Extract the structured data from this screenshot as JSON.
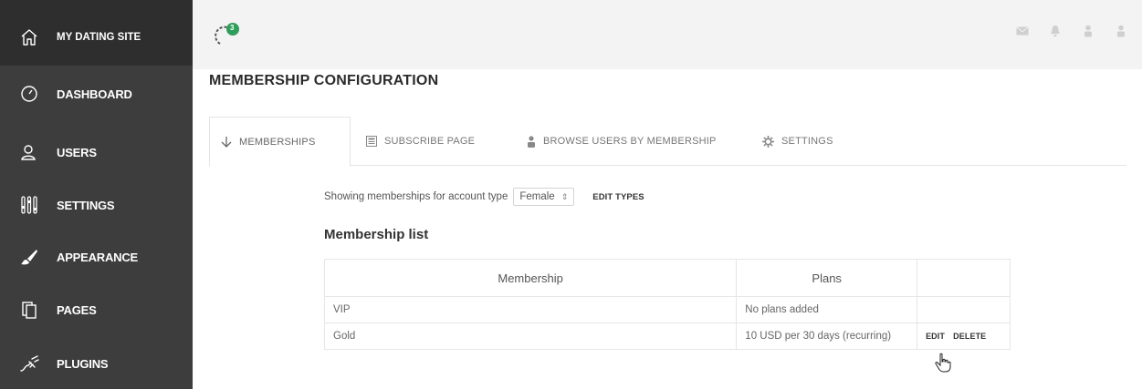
{
  "sidebar": {
    "brand": {
      "label": "MY DATING SITE",
      "icon": "home-icon"
    },
    "items": [
      {
        "label": "DASHBOARD",
        "icon": "speedometer-icon"
      },
      {
        "label": "USERS",
        "icon": "users-icon"
      },
      {
        "label": "SETTINGS",
        "icon": "sliders-icon"
      },
      {
        "label": "APPEARANCE",
        "icon": "brush-icon"
      },
      {
        "label": "PAGES",
        "icon": "pages-icon"
      },
      {
        "label": "PLUGINS",
        "icon": "plug-icon"
      }
    ]
  },
  "topbar": {
    "logo_icon": "spinner-logo-icon",
    "notification_count": "3",
    "icons": [
      "mail-icon",
      "bell-icon",
      "user-icon",
      "user-icon"
    ]
  },
  "page": {
    "title": "MEMBERSHIP CONFIGURATION"
  },
  "tabs": [
    {
      "label": "MEMBERSHIPS",
      "icon": "arrow-down-icon",
      "active": true
    },
    {
      "label": "SUBSCRIBE PAGE",
      "icon": "page-icon",
      "active": false
    },
    {
      "label": "BROWSE USERS BY MEMBERSHIP",
      "icon": "user-icon",
      "active": false
    },
    {
      "label": "SETTINGS",
      "icon": "gear-icon",
      "active": false
    }
  ],
  "filter": {
    "prefix": "Showing memberships for account type",
    "account_type": "Female",
    "edit_types_label": "EDIT TYPES"
  },
  "membership_list": {
    "title": "Membership list",
    "columns": [
      "Membership",
      "Plans"
    ],
    "rows": [
      {
        "membership": "VIP",
        "plans": "No plans added",
        "actions": []
      },
      {
        "membership": "Gold",
        "plans": "10 USD per 30 days (recurring)",
        "actions": [
          "EDIT",
          "DELETE"
        ]
      }
    ]
  },
  "colors": {
    "sidebar_bg": "#3d3d3d",
    "sidebar_brand_bg": "#2e2e2e",
    "topbar_bg": "#f3f3f3",
    "badge_green": "#2e9e5b"
  }
}
